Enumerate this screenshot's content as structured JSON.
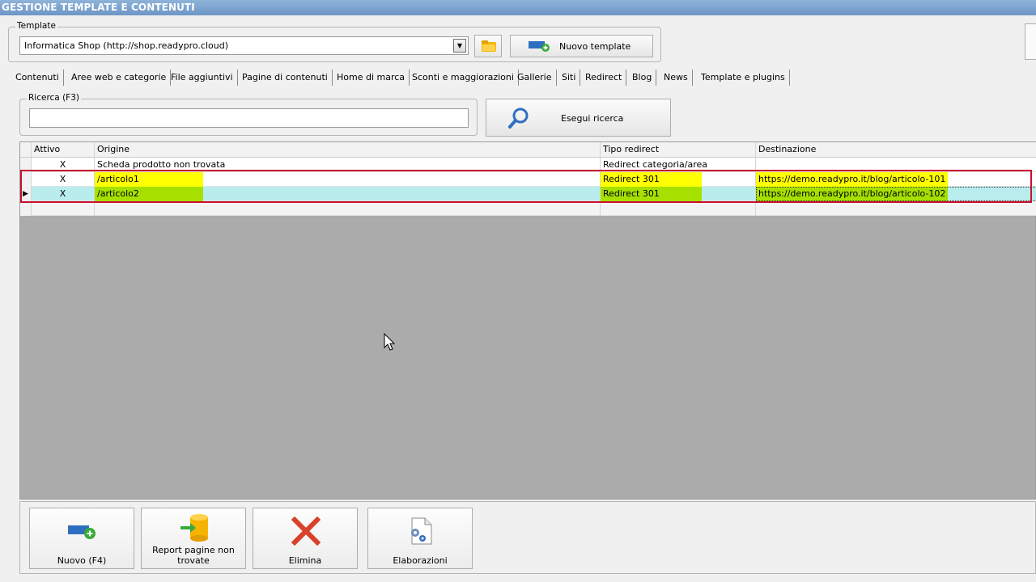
{
  "window": {
    "title": "GESTIONE TEMPLATE E CONTENUTI"
  },
  "template_group": {
    "label": "Template",
    "selected": "Informatica Shop (http://shop.readypro.cloud)",
    "new_button": "Nuovo template"
  },
  "tabs": [
    "Contenuti",
    "Aree web e categorie",
    "File aggiuntivi",
    "Pagine di contenuti",
    "Home di marca",
    "Sconti e maggiorazioni",
    "Gallerie",
    "Siti",
    "Redirect",
    "Blog",
    "News",
    "Template e plugins"
  ],
  "active_tab": "Redirect",
  "search": {
    "label": "Ricerca (F3)",
    "value": "",
    "button": "Esegui ricerca"
  },
  "grid": {
    "columns": [
      "Attivo",
      "Origine",
      "Tipo redirect",
      "Destinazione"
    ],
    "rows": [
      {
        "attivo": "X",
        "origine": "Scheda prodotto non trovata",
        "tipo": "Redirect categoria/area",
        "destinazione": ""
      },
      {
        "attivo": "X",
        "origine": "/articolo1",
        "tipo": "Redirect 301",
        "destinazione": "https://demo.readypro.it/blog/articolo-101"
      },
      {
        "attivo": "X",
        "origine": "/articolo2",
        "tipo": "Redirect 301",
        "destinazione": "https://demo.readypro.it/blog/articolo-102"
      }
    ]
  },
  "bottom_buttons": {
    "nuovo": "Nuovo (F4)",
    "report_line1": "Report pagine non",
    "report_line2": "trovate",
    "elimina": "Elimina",
    "elaborazioni": "Elaborazioni"
  },
  "colors": {
    "highlight_yellow": "#ffff00",
    "highlight_green": "#a6e000",
    "selected_row": "#b9ecec",
    "annotation_red": "#c8102e"
  }
}
